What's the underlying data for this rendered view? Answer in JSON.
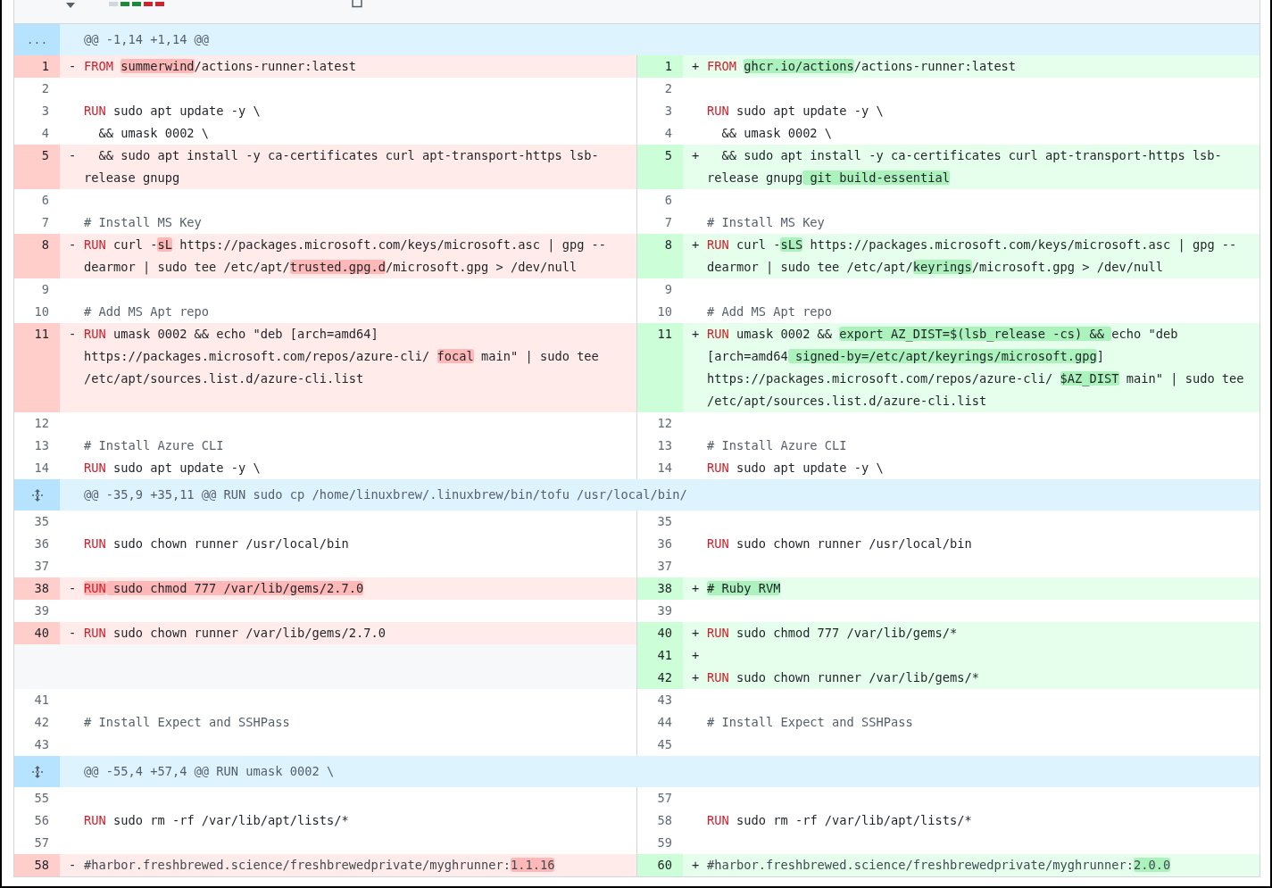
{
  "hunks": [
    {
      "gutter": {
        "kind": "text",
        "text": "..."
      },
      "header": "@@ -1,14 +1,14 @@",
      "rows": [
        {
          "left": {
            "kind": "deleted",
            "n": "1",
            "sign": "-",
            "code": [
              {
                "t": "FROM ",
                "color": "#cf222e"
              },
              {
                "t": "summerwind",
                "hl": true
              },
              {
                "t": "/actions-runner:latest"
              }
            ]
          },
          "right": {
            "kind": "added",
            "n": "1",
            "sign": "+",
            "code": [
              {
                "t": "FROM ",
                "color": "#cf222e"
              },
              {
                "t": "ghcr.io/actions",
                "hl": true
              },
              {
                "t": "/actions-runner:latest"
              }
            ]
          }
        },
        {
          "left": {
            "kind": "context",
            "n": "2"
          },
          "right": {
            "kind": "context",
            "n": "2"
          }
        },
        {
          "left": {
            "kind": "context",
            "n": "3",
            "code": [
              {
                "t": "RUN",
                "color": "#cf222e"
              },
              {
                "t": " sudo apt update -y \\"
              }
            ]
          },
          "right": {
            "kind": "context",
            "n": "3",
            "code": [
              {
                "t": "RUN",
                "color": "#cf222e"
              },
              {
                "t": " sudo apt update -y \\"
              }
            ]
          }
        },
        {
          "left": {
            "kind": "context",
            "n": "4",
            "code": [
              {
                "t": "  && umask 0002 \\"
              }
            ]
          },
          "right": {
            "kind": "context",
            "n": "4",
            "code": [
              {
                "t": "  && umask 0002 \\"
              }
            ]
          }
        },
        {
          "left": {
            "kind": "deleted",
            "n": "5",
            "sign": "-",
            "code": [
              {
                "t": "  && sudo apt install -y ca-certificates curl apt-transport-https lsb-release gnupg"
              }
            ]
          },
          "right": {
            "kind": "added",
            "n": "5",
            "sign": "+",
            "code": [
              {
                "t": "  && sudo apt install -y ca-certificates curl apt-transport-https lsb-release gnupg"
              },
              {
                "t": " git build-essential",
                "hl": true
              }
            ]
          }
        },
        {
          "left": {
            "kind": "context",
            "n": "6"
          },
          "right": {
            "kind": "context",
            "n": "6"
          }
        },
        {
          "left": {
            "kind": "context",
            "n": "7",
            "code": [
              {
                "t": "# Install MS Key",
                "color": "#57606a"
              }
            ]
          },
          "right": {
            "kind": "context",
            "n": "7",
            "code": [
              {
                "t": "# Install MS Key",
                "color": "#57606a"
              }
            ]
          }
        },
        {
          "left": {
            "kind": "deleted",
            "n": "8",
            "sign": "-",
            "code": [
              {
                "t": "RUN",
                "color": "#cf222e"
              },
              {
                "t": " curl -"
              },
              {
                "t": "sL",
                "hl": true
              },
              {
                "t": " https://packages.microsoft.com/keys/microsoft.asc | gpg --dearmor | sudo tee /etc/apt/"
              },
              {
                "t": "trusted.gpg.d",
                "hl": true
              },
              {
                "t": "/microsoft.gpg > /dev/null"
              }
            ]
          },
          "right": {
            "kind": "added",
            "n": "8",
            "sign": "+",
            "code": [
              {
                "t": "RUN",
                "color": "#cf222e"
              },
              {
                "t": " curl -"
              },
              {
                "t": "sLS",
                "hl": true
              },
              {
                "t": " https://packages.microsoft.com/keys/microsoft.asc | gpg --dearmor | sudo tee /etc/apt/"
              },
              {
                "t": "keyrings",
                "hl": true
              },
              {
                "t": "/microsoft.gpg > /dev/null"
              }
            ]
          }
        },
        {
          "left": {
            "kind": "context",
            "n": "9"
          },
          "right": {
            "kind": "context",
            "n": "9"
          }
        },
        {
          "left": {
            "kind": "context",
            "n": "10",
            "code": [
              {
                "t": "# Add MS Apt repo",
                "color": "#57606a"
              }
            ]
          },
          "right": {
            "kind": "context",
            "n": "10",
            "code": [
              {
                "t": "# Add MS Apt repo",
                "color": "#57606a"
              }
            ]
          }
        },
        {
          "left": {
            "kind": "deleted",
            "n": "11",
            "sign": "-",
            "code": [
              {
                "t": "RUN",
                "color": "#cf222e"
              },
              {
                "t": " umask 0002 && echo \"deb [arch=amd64] https://packages.microsoft.com/repos/azure-cli/ "
              },
              {
                "t": "focal",
                "hl": true
              },
              {
                "t": " main\" | sudo tee /etc/apt/sources.list.d/azure-cli.list"
              }
            ]
          },
          "right": {
            "kind": "added",
            "n": "11",
            "sign": "+",
            "code": [
              {
                "t": "RUN",
                "color": "#cf222e"
              },
              {
                "t": " umask 0002 && "
              },
              {
                "t": "export AZ_DIST=$(lsb_release -cs) && ",
                "hl": true
              },
              {
                "t": "echo \"deb [arch=amd64"
              },
              {
                "t": " signed-by=/etc/apt/keyrings/microsoft.gpg",
                "hl": true
              },
              {
                "t": "] https://packages.microsoft.com/repos/azure-cli/ "
              },
              {
                "t": "$AZ_DIST",
                "hl": true
              },
              {
                "t": " main\" | sudo tee /etc/apt/sources.list.d/azure-cli.list"
              }
            ]
          }
        },
        {
          "left": {
            "kind": "context",
            "n": "12"
          },
          "right": {
            "kind": "context",
            "n": "12"
          }
        },
        {
          "left": {
            "kind": "context",
            "n": "13",
            "code": [
              {
                "t": "# Install Azure CLI",
                "color": "#57606a"
              }
            ]
          },
          "right": {
            "kind": "context",
            "n": "13",
            "code": [
              {
                "t": "# Install Azure CLI",
                "color": "#57606a"
              }
            ]
          }
        },
        {
          "left": {
            "kind": "context",
            "n": "14",
            "code": [
              {
                "t": "RUN",
                "color": "#cf222e"
              },
              {
                "t": " sudo apt update -y \\"
              }
            ]
          },
          "right": {
            "kind": "context",
            "n": "14",
            "code": [
              {
                "t": "RUN",
                "color": "#cf222e"
              },
              {
                "t": " sudo apt update -y \\"
              }
            ]
          }
        }
      ]
    },
    {
      "gutter": {
        "kind": "expand"
      },
      "header": "@@ -35,9 +35,11 @@ RUN sudo cp /home/linuxbrew/.linuxbrew/bin/tofu /usr/local/bin/",
      "rows": [
        {
          "left": {
            "kind": "context",
            "n": "35"
          },
          "right": {
            "kind": "context",
            "n": "35"
          }
        },
        {
          "left": {
            "kind": "context",
            "n": "36",
            "code": [
              {
                "t": "RUN",
                "color": "#cf222e"
              },
              {
                "t": " sudo chown runner /usr/local/bin"
              }
            ]
          },
          "right": {
            "kind": "context",
            "n": "36",
            "code": [
              {
                "t": "RUN",
                "color": "#cf222e"
              },
              {
                "t": " sudo chown runner /usr/local/bin"
              }
            ]
          }
        },
        {
          "left": {
            "kind": "context",
            "n": "37"
          },
          "right": {
            "kind": "context",
            "n": "37"
          }
        },
        {
          "left": {
            "kind": "deleted",
            "n": "38",
            "sign": "-",
            "code": [
              {
                "t": "RUN",
                "color": "#cf222e",
                "hl": true
              },
              {
                "t": " sudo chmod 777 /var/lib/gems/2.7.0",
                "hl": true
              }
            ]
          },
          "right": {
            "kind": "added",
            "n": "38",
            "sign": "+",
            "code": [
              {
                "t": "# Ruby RVM",
                "hl": true
              }
            ]
          }
        },
        {
          "left": {
            "kind": "context",
            "n": "39"
          },
          "right": {
            "kind": "context",
            "n": "39"
          }
        },
        {
          "left": {
            "kind": "deleted",
            "n": "40",
            "sign": "-",
            "code": [
              {
                "t": "RUN",
                "color": "#cf222e"
              },
              {
                "t": " sudo chown runner /var/lib/gems/2.7.0"
              }
            ]
          },
          "right": {
            "kind": "added",
            "n": "40",
            "sign": "+",
            "code": [
              {
                "t": "RUN",
                "color": "#cf222e"
              },
              {
                "t": " sudo chmod 777 /var/lib/gems/*"
              }
            ]
          }
        },
        {
          "left": {
            "kind": "empty"
          },
          "right": {
            "kind": "added",
            "n": "41",
            "sign": "+"
          }
        },
        {
          "left": {
            "kind": "empty"
          },
          "right": {
            "kind": "added",
            "n": "42",
            "sign": "+",
            "code": [
              {
                "t": "RUN",
                "color": "#cf222e"
              },
              {
                "t": " sudo chown runner /var/lib/gems/*"
              }
            ]
          }
        },
        {
          "left": {
            "kind": "context",
            "n": "41"
          },
          "right": {
            "kind": "context",
            "n": "43"
          }
        },
        {
          "left": {
            "kind": "context",
            "n": "42",
            "code": [
              {
                "t": "# Install Expect and SSHPass",
                "color": "#57606a"
              }
            ]
          },
          "right": {
            "kind": "context",
            "n": "44",
            "code": [
              {
                "t": "# Install Expect and SSHPass",
                "color": "#57606a"
              }
            ]
          }
        },
        {
          "left": {
            "kind": "context",
            "n": "43"
          },
          "right": {
            "kind": "context",
            "n": "45"
          }
        }
      ]
    },
    {
      "gutter": {
        "kind": "expand"
      },
      "header": "@@ -55,4 +57,4 @@ RUN umask 0002 \\",
      "rows": [
        {
          "left": {
            "kind": "context",
            "n": "55"
          },
          "right": {
            "kind": "context",
            "n": "57"
          }
        },
        {
          "left": {
            "kind": "context",
            "n": "56",
            "code": [
              {
                "t": "RUN",
                "color": "#cf222e"
              },
              {
                "t": " sudo rm -rf /var/lib/apt/lists/*"
              }
            ]
          },
          "right": {
            "kind": "context",
            "n": "58",
            "code": [
              {
                "t": "RUN",
                "color": "#cf222e"
              },
              {
                "t": " sudo rm -rf /var/lib/apt/lists/*"
              }
            ]
          }
        },
        {
          "left": {
            "kind": "context",
            "n": "57"
          },
          "right": {
            "kind": "context",
            "n": "59"
          }
        },
        {
          "left": {
            "kind": "deleted",
            "n": "58",
            "sign": "-",
            "code": [
              {
                "t": "#harbor.freshbrewed.science/freshbrewedprivate/myghrunner:",
                "color": "#424a53"
              },
              {
                "t": "1.1.16",
                "color": "#424a53",
                "hl": true
              }
            ]
          },
          "right": {
            "kind": "added",
            "n": "60",
            "sign": "+",
            "code": [
              {
                "t": "#harbor.freshbrewed.science/freshbrewedprivate/myghrunner:",
                "color": "#424a53"
              },
              {
                "t": "2.0.0",
                "color": "#424a53",
                "hl": true
              }
            ]
          }
        }
      ]
    }
  ]
}
